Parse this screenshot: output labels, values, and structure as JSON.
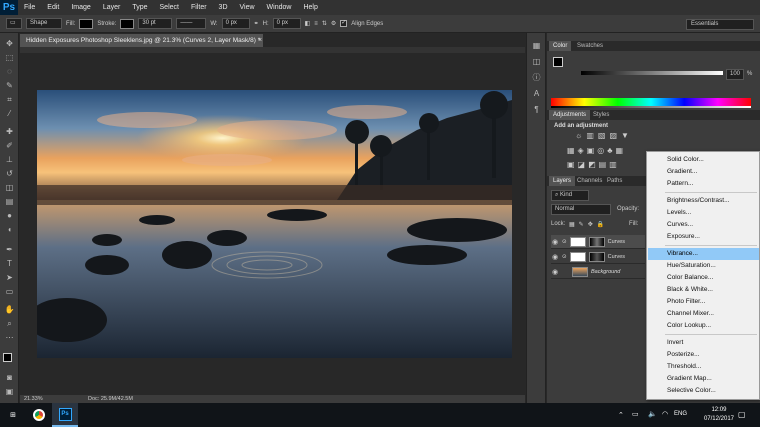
{
  "app": {
    "logo": "Ps"
  },
  "menubar": {
    "items": [
      "File",
      "Edit",
      "Image",
      "Layer",
      "Type",
      "Select",
      "Filter",
      "3D",
      "View",
      "Window",
      "Help"
    ]
  },
  "options": {
    "shape_mode": "Shape",
    "fill_label": "Fill:",
    "stroke_label": "Stroke:",
    "stroke_width": "30 pt",
    "w_label": "W:",
    "w_value": "0 px",
    "h_label": "H:",
    "h_value": "0 px",
    "align_edges": "Align Edges",
    "workspace": "Essentials"
  },
  "document": {
    "tab_title": "Hidden Exposures Photoshop Sleeklens.jpg @ 21.3% (Curves 2, Layer Mask/8) *",
    "close": "×",
    "zoom": "21.33%",
    "doc_size": "Doc: 25.9M/42.5M"
  },
  "color_panel": {
    "tab_color": "Color",
    "tab_swatches": "Swatches",
    "value": "100",
    "unit": "%"
  },
  "adjustments_panel": {
    "tab_adjustments": "Adjustments",
    "tab_styles": "Styles",
    "title": "Add an adjustment"
  },
  "layers_panel": {
    "tab_layers": "Layers",
    "tab_channels": "Channels",
    "tab_paths": "Paths",
    "filter_kind": "Kind",
    "blend_mode": "Normal",
    "opacity_label": "Opacity:",
    "lock_label": "Lock:",
    "fill_label": "Fill:",
    "layers": [
      {
        "name": "Curves"
      },
      {
        "name": "Curves"
      },
      {
        "name": "Background"
      }
    ]
  },
  "context_menu": {
    "groups": [
      [
        "Solid Color...",
        "Gradient...",
        "Pattern..."
      ],
      [
        "Brightness/Contrast...",
        "Levels...",
        "Curves...",
        "Exposure..."
      ],
      [
        "Vibrance...",
        "Hue/Saturation...",
        "Color Balance...",
        "Black & White...",
        "Photo Filter...",
        "Channel Mixer...",
        "Color Lookup..."
      ],
      [
        "Invert",
        "Posterize...",
        "Threshold...",
        "Gradient Map...",
        "Selective Color..."
      ]
    ],
    "highlighted": "Vibrance..."
  },
  "taskbar": {
    "lang": "ENG",
    "time": "12:09",
    "date": "07/12/2017"
  },
  "colors": {
    "accent_blue": "#31a8ff",
    "highlight": "#91c9f7"
  }
}
